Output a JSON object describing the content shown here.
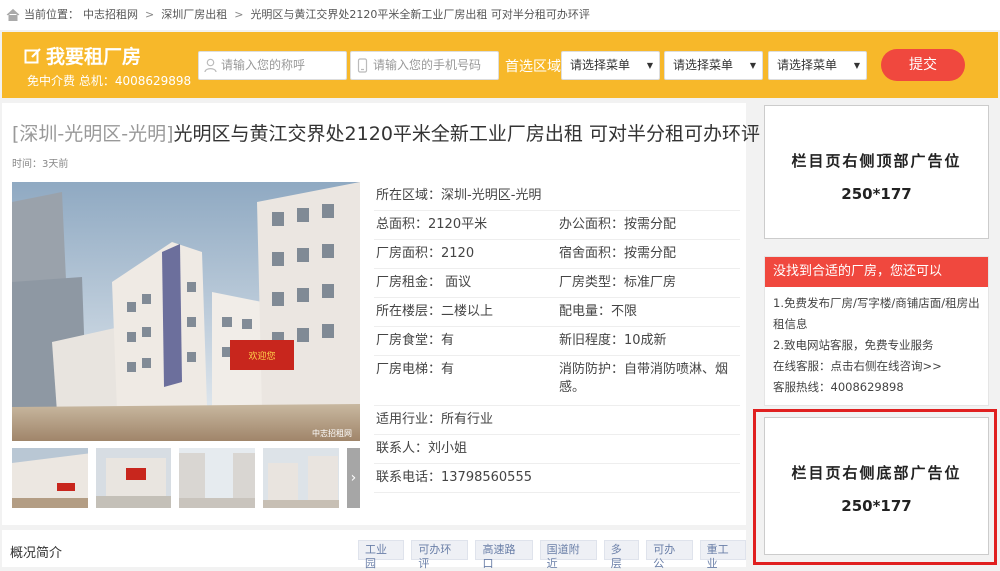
{
  "breadcrumb": {
    "prefix": "当前位置：",
    "items": [
      "中志招租网",
      "深圳厂房出租",
      "光明区与黄江交界处2120平米全新工业厂房出租 可对半分租可办环评"
    ],
    "separator": ">"
  },
  "banner": {
    "title": "我要租厂房",
    "subtitle": "免中介费 总机：4008629898",
    "name_placeholder": "请输入您的称呼",
    "phone_placeholder": "请输入您的手机号码",
    "area_label": "首选区域",
    "selects": [
      "请选择菜单",
      "请选择菜单",
      "请选择菜单"
    ],
    "submit_label": "提交"
  },
  "listing": {
    "region": "[深圳-光明区-光明]",
    "title": "光明区与黄江交界处2120平米全新工业厂房出租 可对半分租可办环评",
    "time": "时间：3天前",
    "photo_watermark": "中志招租网",
    "building_banner_text": "欢迎您",
    "info_rows": [
      [
        "所在区域：深圳-光明区-光明"
      ],
      [
        "总面积：2120平米",
        "办公面积：按需分配"
      ],
      [
        "厂房面积：2120",
        "宿舍面积：按需分配"
      ],
      [
        "厂房租金： 面议",
        "厂房类型：标准厂房"
      ],
      [
        "所在楼层：二楼以上",
        "配电量：不限"
      ],
      [
        "厂房食堂：有",
        "新旧程度：10成新"
      ],
      [
        "厂房电梯：有",
        "消防防护：自带消防喷淋、烟感。"
      ],
      [
        "适用行业：所有行业"
      ],
      [
        "联系人：刘小姐"
      ],
      [
        "联系电话：13798560555"
      ]
    ]
  },
  "intro": {
    "heading": "概况简介",
    "tags": [
      "工业园",
      "可办环评",
      "高速路口",
      "国道附近",
      "多层",
      "可办公",
      "重工业"
    ]
  },
  "sidebar": {
    "ad_top": {
      "line1": "栏目页右侧顶部广告位",
      "line2": "250*177"
    },
    "help": {
      "header": "没找到合适的厂房，您还可以",
      "lines": [
        "1.免费发布厂房/写字楼/商铺店面/租房出租信息",
        "2.致电网站客服，免费专业服务",
        "在线客服：点击右侧在线咨询>>",
        "客服热线：4008629898"
      ]
    },
    "ad_bottom": {
      "line1": "栏目页右侧底部广告位",
      "line2": "250*177"
    }
  },
  "colors": {
    "banner": "#f7b82a",
    "accent": "#f0483e",
    "highlight": "#e02020"
  }
}
